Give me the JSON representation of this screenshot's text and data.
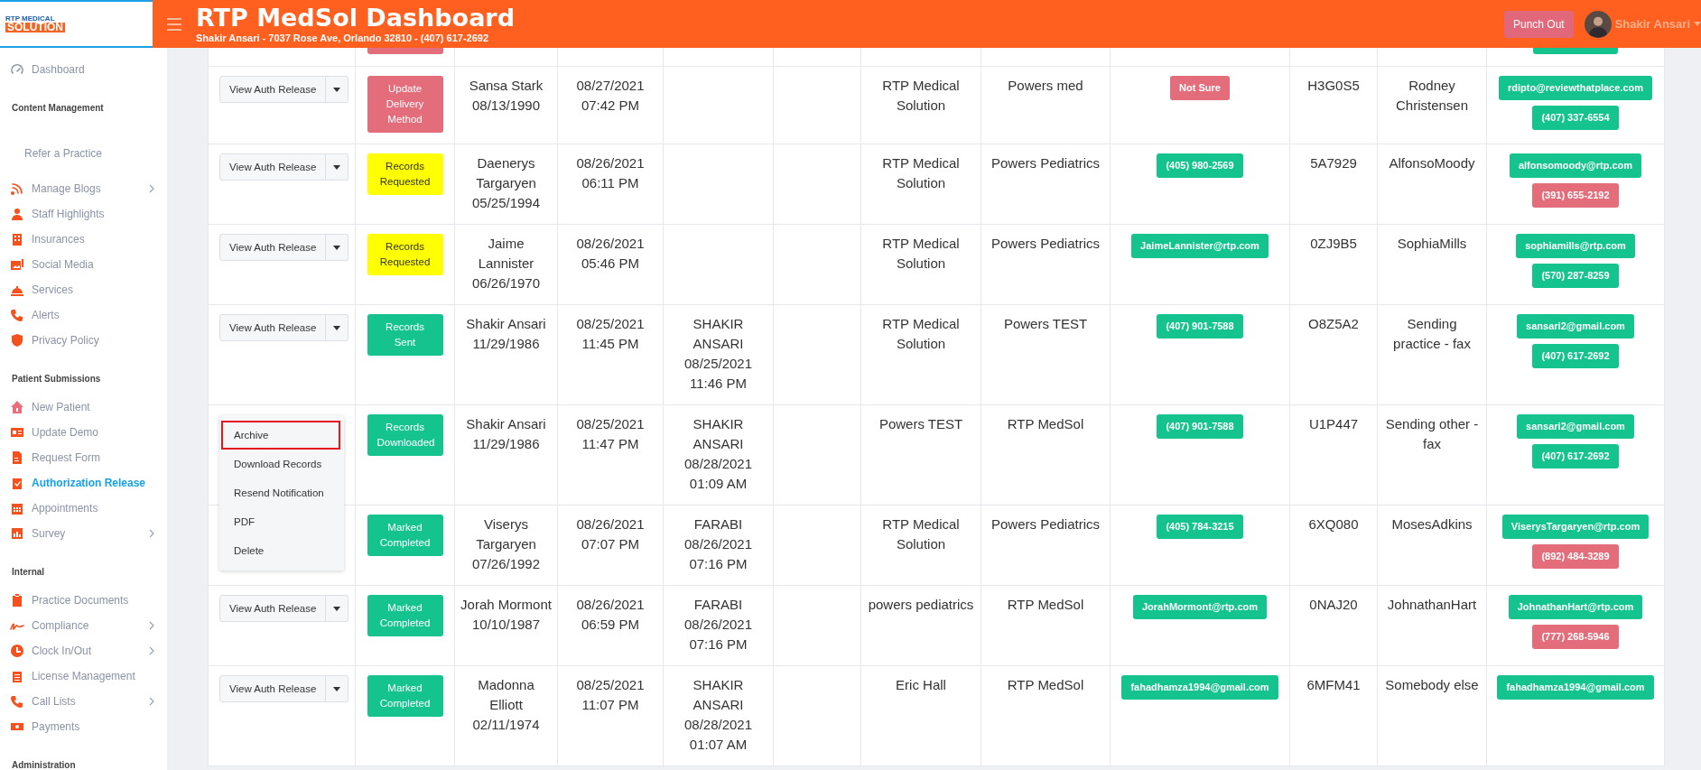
{
  "header": {
    "logo": [
      "RTP MEDICAL",
      "SOLUTION"
    ],
    "title": "RTP MedSol Dashboard",
    "subtitle": "Shakir Ansari - 7037 Rose Ave, Orlando 32810 - (407) 617-2692",
    "punch_button": "Punch Out",
    "user": "Shakir Ansari"
  },
  "sidebar": {
    "sections": [
      {
        "items": [
          {
            "label": "Dashboard",
            "selected": false,
            "submenu": false
          }
        ]
      },
      {
        "heading": "Content Management",
        "items": [
          {
            "label": "Refer a Practice",
            "selected": false,
            "submenu": false
          },
          {
            "label": "Manage Blogs",
            "selected": false,
            "submenu": true
          },
          {
            "label": "Staff Highlights",
            "selected": false,
            "submenu": false
          },
          {
            "label": "Insurances",
            "selected": false,
            "submenu": false
          },
          {
            "label": "Social Media",
            "selected": false,
            "submenu": false
          },
          {
            "label": "Services",
            "selected": false,
            "submenu": false
          },
          {
            "label": "Alerts",
            "selected": false,
            "submenu": false
          },
          {
            "label": "Privacy Policy",
            "selected": false,
            "submenu": false
          }
        ]
      },
      {
        "heading": "Patient Submissions",
        "items": [
          {
            "label": "New Patient",
            "selected": false,
            "submenu": false
          },
          {
            "label": "Update Demo",
            "selected": false,
            "submenu": false
          },
          {
            "label": "Request Form",
            "selected": false,
            "submenu": false
          },
          {
            "label": "Authorization Release",
            "selected": true,
            "submenu": false
          },
          {
            "label": "Appointments",
            "selected": false,
            "submenu": false
          },
          {
            "label": "Survey",
            "selected": false,
            "submenu": true
          }
        ]
      },
      {
        "heading": "Internal",
        "items": [
          {
            "label": "Practice Documents",
            "selected": false,
            "submenu": false
          },
          {
            "label": "Compliance",
            "selected": false,
            "submenu": true
          },
          {
            "label": "Clock In/Out",
            "selected": false,
            "submenu": true
          },
          {
            "label": "License Management",
            "selected": false,
            "submenu": false
          },
          {
            "label": "Call Lists",
            "selected": false,
            "submenu": true
          },
          {
            "label": "Payments",
            "selected": false,
            "submenu": false
          }
        ]
      },
      {
        "heading": "Administration"
      }
    ]
  },
  "table": {
    "rows": [
      {
        "action": "View Auth Release",
        "status": {
          "label": "Update Delivery Method",
          "kind": "danger"
        },
        "patient": "Sansa Stark",
        "dob": "08/13/1990",
        "submitted": "08/27/2021 07:42 PM",
        "practice": "RTP Medical Solution",
        "provider": "Powers med",
        "contact": {
          "text": "Not Sure",
          "kind": "danger"
        },
        "code": "H3G0S5",
        "name": "Rodney Christensen",
        "contacts": [
          {
            "text": "rdipto@reviewthatplace.com",
            "kind": "success"
          },
          {
            "text": "(407) 337-6554",
            "kind": "success"
          }
        ]
      },
      {
        "action": "View Auth Release",
        "status": {
          "label": "Records Requested",
          "kind": "warning"
        },
        "patient": "Daenerys Targaryen",
        "dob": "05/25/1994",
        "submitted": "08/26/2021 06:11 PM",
        "practice": "RTP Medical Solution",
        "provider": "Powers Pediatrics",
        "contact": {
          "text": "(405) 980-2569",
          "kind": "success"
        },
        "code": "5A7929",
        "name": "AlfonsoMoody",
        "contacts": [
          {
            "text": "alfonsomoody@rtp.com",
            "kind": "success"
          },
          {
            "text": "(391) 655-2192",
            "kind": "danger"
          }
        ]
      },
      {
        "action": "View Auth Release",
        "status": {
          "label": "Records Requested",
          "kind": "warning"
        },
        "patient": "Jaime Lannister",
        "dob": "06/26/1970",
        "submitted": "08/26/2021 05:46 PM",
        "practice": "RTP Medical Solution",
        "provider": "Powers Pediatrics",
        "contact": {
          "text": "JaimeLannister@rtp.com",
          "kind": "success"
        },
        "code": "0ZJ9B5",
        "name": "SophiaMills",
        "contacts": [
          {
            "text": "sophiamills@rtp.com",
            "kind": "success"
          },
          {
            "text": "(570) 287-8259",
            "kind": "success"
          }
        ]
      },
      {
        "action": "View Auth Release",
        "status": {
          "label": "Records Sent",
          "kind": "success"
        },
        "patient": "Shakir Ansari",
        "dob": "11/29/1986",
        "submitted": "08/25/2021 11:45 PM",
        "completed_by": "SHAKIR ANSARI",
        "completed_at": "08/25/2021 11:46 PM",
        "practice": "RTP Medical Solution",
        "provider": "Powers TEST",
        "contact": {
          "text": "(407) 901-7588",
          "kind": "success"
        },
        "code": "O8Z5A2",
        "name": "Sending practice - fax",
        "contacts": [
          {
            "text": "sansari2@gmail.com",
            "kind": "success"
          },
          {
            "text": "(407) 617-2692",
            "kind": "success"
          }
        ]
      },
      {
        "menu": [
          {
            "label": "Archive",
            "highlighted": true
          },
          {
            "label": "Download Records",
            "highlighted": false
          },
          {
            "label": "Resend Notification",
            "highlighted": false
          },
          {
            "label": "PDF",
            "highlighted": false
          },
          {
            "label": "Delete",
            "highlighted": false
          }
        ],
        "status": {
          "label": "Records Downloaded",
          "kind": "success"
        },
        "patient": "Shakir Ansari",
        "dob": "11/29/1986",
        "submitted": "08/25/2021 11:47 PM",
        "completed_by": "SHAKIR ANSARI",
        "completed_at": "08/28/2021 01:09 AM",
        "practice": "Powers TEST",
        "provider": "RTP MedSol",
        "contact": {
          "text": "(407) 901-7588",
          "kind": "success"
        },
        "code": "U1P447",
        "name": "Sending other - fax",
        "contacts": [
          {
            "text": "sansari2@gmail.com",
            "kind": "success"
          },
          {
            "text": "(407) 617-2692",
            "kind": "success"
          }
        ]
      },
      {
        "status": {
          "label": "Marked Completed",
          "kind": "success"
        },
        "patient": "Viserys Targaryen",
        "dob": "07/26/1992",
        "submitted": "08/26/2021 07:07 PM",
        "completed_by": "FARABI",
        "completed_at": "08/26/2021 07:16 PM",
        "practice": "RTP Medical Solution",
        "provider": "Powers Pediatrics",
        "contact": {
          "text": "(405) 784-3215",
          "kind": "success"
        },
        "code": "6XQ080",
        "name": "MosesAdkins",
        "contacts": [
          {
            "text": "ViserysTargaryen@rtp.com",
            "kind": "success"
          },
          {
            "text": "(892) 484-3289",
            "kind": "danger"
          }
        ]
      },
      {
        "action": "View Auth Release",
        "status": {
          "label": "Marked Completed",
          "kind": "success"
        },
        "patient": "Jorah Mormont",
        "dob": "10/10/1987",
        "submitted": "08/26/2021 06:59 PM",
        "completed_by": "FARABI",
        "completed_at": "08/26/2021 07:16 PM",
        "practice": "powers pediatrics",
        "provider": "RTP MedSol",
        "contact": {
          "text": "JorahMormont@rtp.com",
          "kind": "success"
        },
        "code": "0NAJ20",
        "name": "JohnathanHart",
        "contacts": [
          {
            "text": "JohnathanHart@rtp.com",
            "kind": "success"
          },
          {
            "text": "(777) 268-5946",
            "kind": "danger"
          }
        ]
      },
      {
        "action": "View Auth Release",
        "status": {
          "label": "Marked Completed",
          "kind": "success"
        },
        "patient": "Madonna Elliott",
        "dob": "02/11/1974",
        "submitted": "08/25/2021 11:07 PM",
        "completed_by": "SHAKIR ANSARI",
        "completed_at": "08/28/2021 01:07 AM",
        "practice": "Eric Hall",
        "provider": "RTP MedSol",
        "contact": {
          "text": "fahadhamza1994@gmail.com",
          "kind": "success"
        },
        "code": "6MFM41",
        "name": "Somebody else",
        "contacts": [
          {
            "text": "fahadhamza1994@gmail.com",
            "kind": "success"
          }
        ]
      }
    ]
  }
}
